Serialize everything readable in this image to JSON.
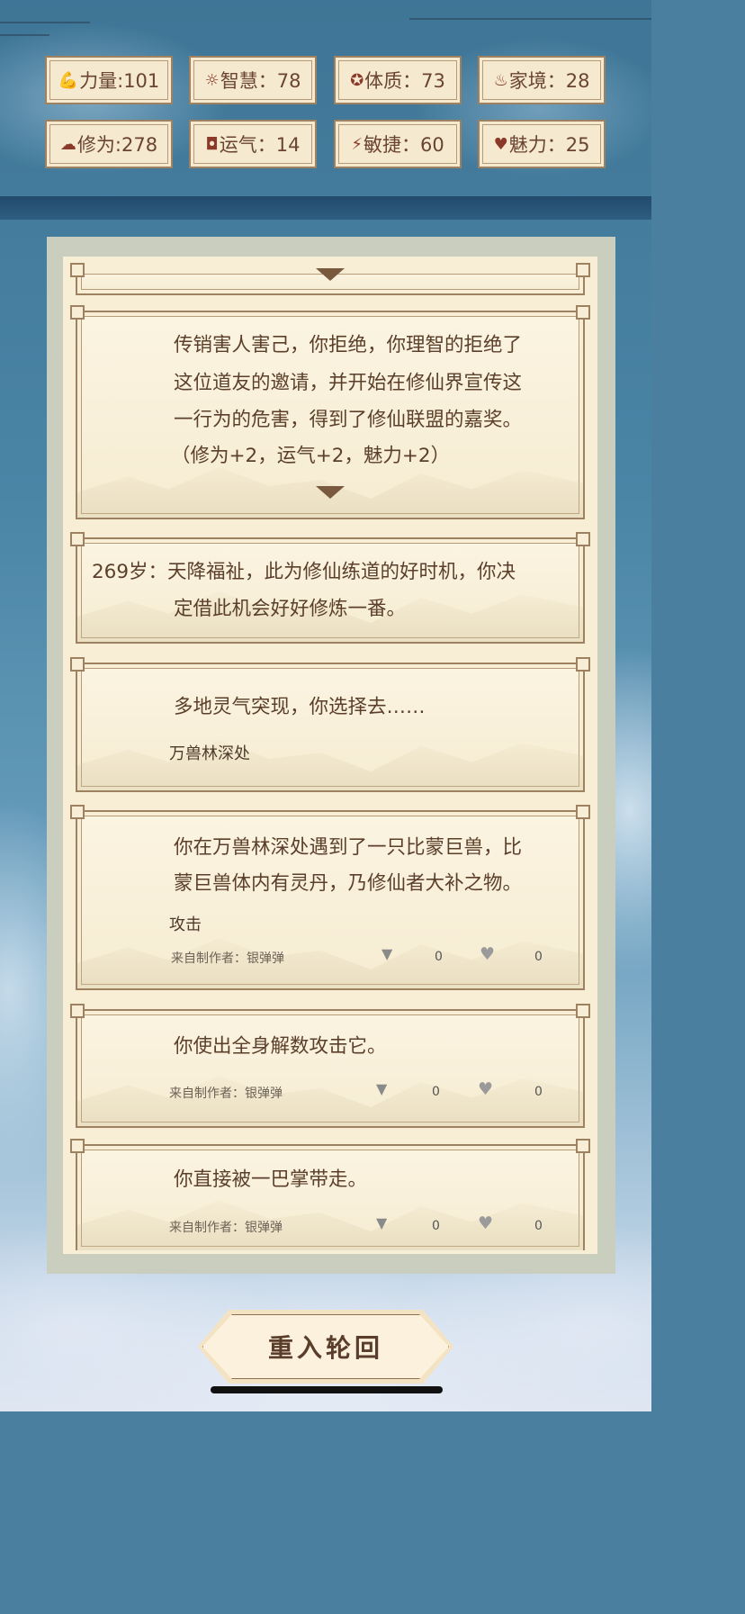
{
  "stats": [
    {
      "icon": "muscle-icon",
      "label": "力量:101"
    },
    {
      "icon": "lightbulb-icon",
      "label": "智慧：78"
    },
    {
      "icon": "body-icon",
      "label": "体质：73"
    },
    {
      "icon": "family-icon",
      "label": "家境：28"
    },
    {
      "icon": "cloud-icon",
      "label": "修为:278"
    },
    {
      "icon": "luck-icon",
      "label": "运气：14"
    },
    {
      "icon": "lightning-icon",
      "label": "敏捷：60"
    },
    {
      "icon": "heart-icon",
      "label": "魅力：25"
    }
  ],
  "events": {
    "e1_line1": "传销害人害己，你拒绝，你理智的拒绝了",
    "e1_line2": "这位道友的邀请，并开始在修仙界宣传这",
    "e1_line3": "一行为的危害，得到了修仙联盟的嘉奖。",
    "e1_line4": "（修为+2，运气+2，魅力+2）",
    "e2_line1": "269岁：天降福祉，此为修仙练道的好时机，你决",
    "e2_line2": "定借此机会好好修炼一番。",
    "e3_text": "多地灵气突现，你选择去……",
    "e3_choice": "万兽林深处",
    "e4_line1": "你在万兽林深处遇到了一只比蒙巨兽，比",
    "e4_line2": "蒙巨兽体内有灵丹，乃修仙者大补之物。",
    "e4_choice": "攻击",
    "e4_author": "来自制作者：银弹弹",
    "e4_dislikes": "0",
    "e4_likes": "0",
    "e5_text": "你使出全身解数攻击它。",
    "e5_author": "来自制作者：银弹弹",
    "e5_dislikes": "0",
    "e5_likes": "0",
    "e6_text": "你直接被一巴掌带走。",
    "e6_author": "来自制作者：银弹弹",
    "e6_dislikes": "0",
    "e6_likes": "0"
  },
  "actions": {
    "reincarnate": "重入轮回"
  },
  "colors": {
    "paper": "#f7eed5",
    "border": "#9d8160",
    "text": "#5b3f2a",
    "sky": "#4a7f9f"
  }
}
